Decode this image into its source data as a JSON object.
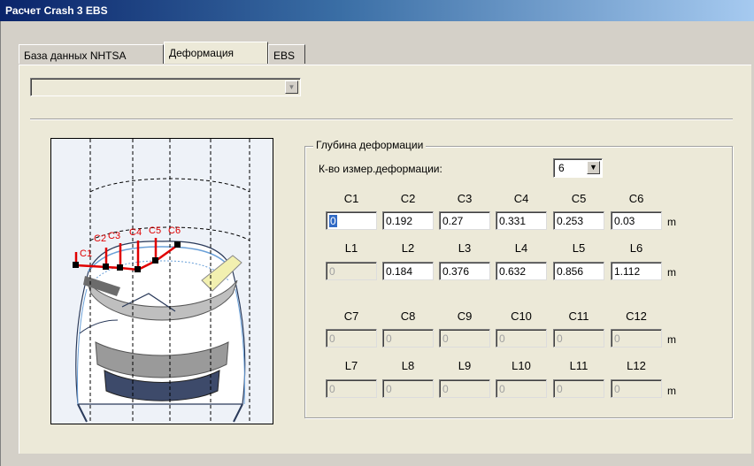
{
  "window": {
    "title": "Расчет Crash 3 EBS"
  },
  "tabs": [
    {
      "label": "База данных NHTSA",
      "active": false
    },
    {
      "label": "Деформация",
      "active": true
    },
    {
      "label": "EBS",
      "active": false
    }
  ],
  "top_combo": {
    "value": ""
  },
  "diagram": {
    "points": [
      "C1",
      "C2",
      "C3",
      "C4",
      "C5",
      "C6"
    ],
    "point_color": "#e00000"
  },
  "deformation": {
    "group_title": "Глубина деформации",
    "count_label": "К-во измер.деформации:",
    "count_value": "6",
    "unit": "m",
    "c_headers_1": [
      "C1",
      "C2",
      "C3",
      "C4",
      "C5",
      "C6"
    ],
    "c_values_1": [
      "0",
      "0.192",
      "0.27",
      "0.331",
      "0.253",
      "0.03"
    ],
    "l_headers_1": [
      "L1",
      "L2",
      "L3",
      "L4",
      "L5",
      "L6"
    ],
    "l_values_1": [
      "0",
      "0.184",
      "0.376",
      "0.632",
      "0.856",
      "1.112"
    ],
    "c_headers_2": [
      "C7",
      "C8",
      "C9",
      "C10",
      "C11",
      "C12"
    ],
    "c_values_2": [
      "0",
      "0",
      "0",
      "0",
      "0",
      "0"
    ],
    "l_headers_2": [
      "L7",
      "L8",
      "L9",
      "L10",
      "L11",
      "L12"
    ],
    "l_values_2": [
      "0",
      "0",
      "0",
      "0",
      "0",
      "0"
    ]
  }
}
